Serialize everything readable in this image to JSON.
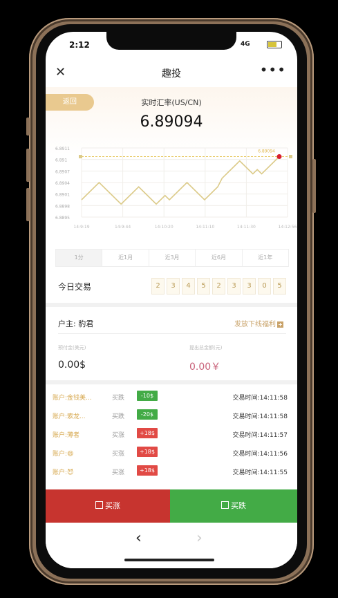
{
  "status": {
    "time": "2:12",
    "network": "4G"
  },
  "nav": {
    "title": "趣投",
    "close": "✕",
    "more": "•••"
  },
  "header": {
    "back_label": "返回",
    "rate_label": "实时汇率(US/CN)",
    "rate_value": "6.89094"
  },
  "chart_data": {
    "type": "line",
    "series_color": "#dccb8a",
    "marker_color": "#d81e2d",
    "last_value_label": "6.89094",
    "y_ticks": [
      "6.8911",
      "6.891",
      "6.8907",
      "6.8904",
      "6.8901",
      "6.8898",
      "6.8895"
    ],
    "x_ticks": [
      "14:9:19",
      "14:9:44",
      "14:10:20",
      "14:11:10",
      "14:11:30",
      "14:12:56"
    ],
    "ylim": [
      6.8895,
      6.8911
    ],
    "values": [
      6.8899,
      6.89,
      6.8901,
      6.8902,
      6.8903,
      6.8902,
      6.8901,
      6.89,
      6.8899,
      6.8898,
      6.8899,
      6.89,
      6.8901,
      6.8902,
      6.8901,
      6.89,
      6.8899,
      6.8898,
      6.8899,
      6.89,
      6.8899,
      6.89,
      6.8901,
      6.8902,
      6.8903,
      6.8902,
      6.8901,
      6.89,
      6.8899,
      6.89,
      6.8901,
      6.8902,
      6.8904,
      6.8905,
      6.8906,
      6.8907,
      6.8908,
      6.8907,
      6.8906,
      6.8905,
      6.8906,
      6.8905,
      6.8906,
      6.8907,
      6.8908,
      6.8909
    ]
  },
  "tabs": [
    "1分",
    "近1月",
    "近3月",
    "近6月",
    "近1年"
  ],
  "today": {
    "label": "今日交易",
    "digits": [
      "2",
      "3",
      "4",
      "5",
      "2",
      "3",
      "3",
      "0",
      "5"
    ]
  },
  "owner": {
    "label": "户主: 豹君",
    "red_packet": "发放下线福利",
    "red_packet_icon": "plus-box-icon"
  },
  "stats": {
    "left": {
      "label": "预付金(美元)",
      "value": "0.00$"
    },
    "right": {
      "label": "提出总金额(元)",
      "value": "0.00￥"
    }
  },
  "trades": [
    {
      "account": "账户:金钱美...",
      "direction": "买跌",
      "amount": "-10$",
      "color": "#43ab46",
      "time": "交易时间:14:11:58"
    },
    {
      "account": "账户:索龙...",
      "direction": "买跌",
      "amount": "-20$",
      "color": "#43ab46",
      "time": "交易时间:14:11:58"
    },
    {
      "account": "账户:薄者",
      "direction": "买涨",
      "amount": "+18$",
      "color": "#e14a45",
      "time": "交易时间:14:11:57"
    },
    {
      "account": "账户:😄",
      "direction": "买涨",
      "amount": "+18$",
      "color": "#e14a45",
      "time": "交易时间:14:11:56"
    },
    {
      "account": "账户:😈",
      "direction": "买涨",
      "amount": "+18$",
      "color": "#e14a45",
      "time": "交易时间:14:11:55"
    }
  ],
  "actions": {
    "rise": "买涨",
    "fall": "买跌"
  },
  "bottom": {
    "prev": "‹",
    "next": "›"
  }
}
